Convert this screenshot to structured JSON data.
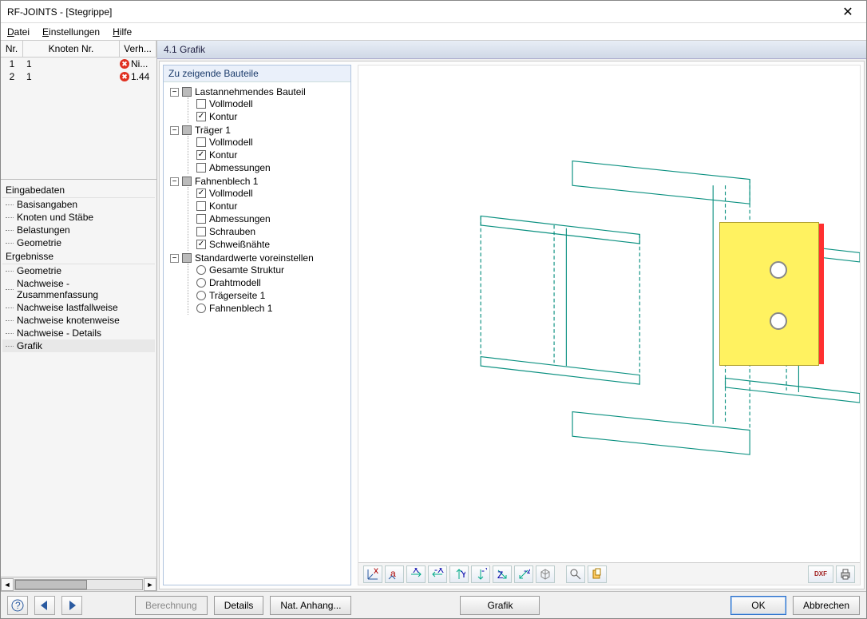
{
  "window": {
    "title": "RF-JOINTS - [Stegrippe]"
  },
  "menu": {
    "file": "Datei",
    "settings": "Einstellungen",
    "help": "Hilfe"
  },
  "table": {
    "headers": {
      "nr": "Nr.",
      "knoten": "Knoten Nr.",
      "verh": "Verh..."
    },
    "rows": [
      {
        "nr": "1",
        "knoten": "1",
        "verh": "Ni..."
      },
      {
        "nr": "2",
        "knoten": "1",
        "verh": "1.44"
      }
    ]
  },
  "nav": {
    "group1": "Eingabedaten",
    "items1": [
      "Basisangaben",
      "Knoten und Stäbe",
      "Belastungen",
      "Geometrie"
    ],
    "group2": "Ergebnisse",
    "items2": [
      "Geometrie",
      "Nachweise - Zusammenfassung",
      "Nachweise lastfallweise",
      "Nachweise knotenweise",
      "Nachweise - Details",
      "Grafik"
    ]
  },
  "panel": {
    "title": "4.1 Grafik"
  },
  "tree": {
    "title": "Zu zeigende Bauteile",
    "n1": "Lastannehmendes Bauteil",
    "n1a": "Vollmodell",
    "n1b": "Kontur",
    "n2": "Träger 1",
    "n2a": "Vollmodell",
    "n2b": "Kontur",
    "n2c": "Abmessungen",
    "n3": "Fahnenblech 1",
    "n3a": "Vollmodell",
    "n3b": "Kontur",
    "n3c": "Abmessungen",
    "n3d": "Schrauben",
    "n3e": "Schweißnähte",
    "n4": "Standardwerte voreinstellen",
    "n4a": "Gesamte Struktur",
    "n4b": "Drahtmodell",
    "n4c": "Trägerseite 1",
    "n4d": "Fahnenblech 1"
  },
  "footer": {
    "berechnung": "Berechnung",
    "details": "Details",
    "anhang": "Nat. Anhang...",
    "grafik": "Grafik",
    "ok": "OK",
    "abbrechen": "Abbrechen"
  },
  "toolbar_right": {
    "dxf": "DXF"
  }
}
